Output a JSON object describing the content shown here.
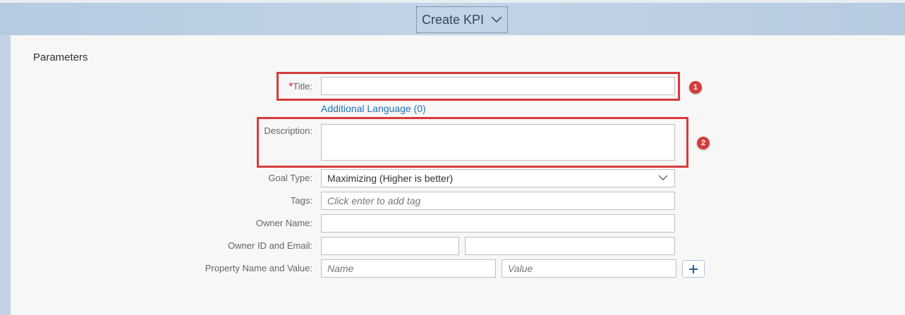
{
  "header": {
    "title": "Create KPI",
    "chevron_icon": "chevron-down-icon"
  },
  "section": {
    "title": "Parameters"
  },
  "form": {
    "title": {
      "required_mark": "*",
      "label": "Title:",
      "value": ""
    },
    "additional_language_link": "Additional Language (0)",
    "description": {
      "label": "Description:",
      "value": ""
    },
    "goal_type": {
      "label": "Goal Type:",
      "value": "Maximizing (Higher is better)"
    },
    "tags": {
      "label": "Tags:",
      "placeholder": "Click enter to add tag"
    },
    "owner_name": {
      "label": "Owner Name:",
      "value": ""
    },
    "owner_id_email": {
      "label": "Owner ID and Email:",
      "id_value": "",
      "email_value": ""
    },
    "property": {
      "label": "Property Name and Value:",
      "name_placeholder": "Name",
      "value_placeholder": "Value"
    },
    "add_button_icon": "plus-icon"
  },
  "annotations": {
    "badge_1": "1",
    "badge_2": "2",
    "color": "#d83a3a"
  },
  "colors": {
    "header_bg": "#c2d4e6",
    "content_bg": "#f7f7f7",
    "link": "#2072b8",
    "required": "#d9252c"
  }
}
